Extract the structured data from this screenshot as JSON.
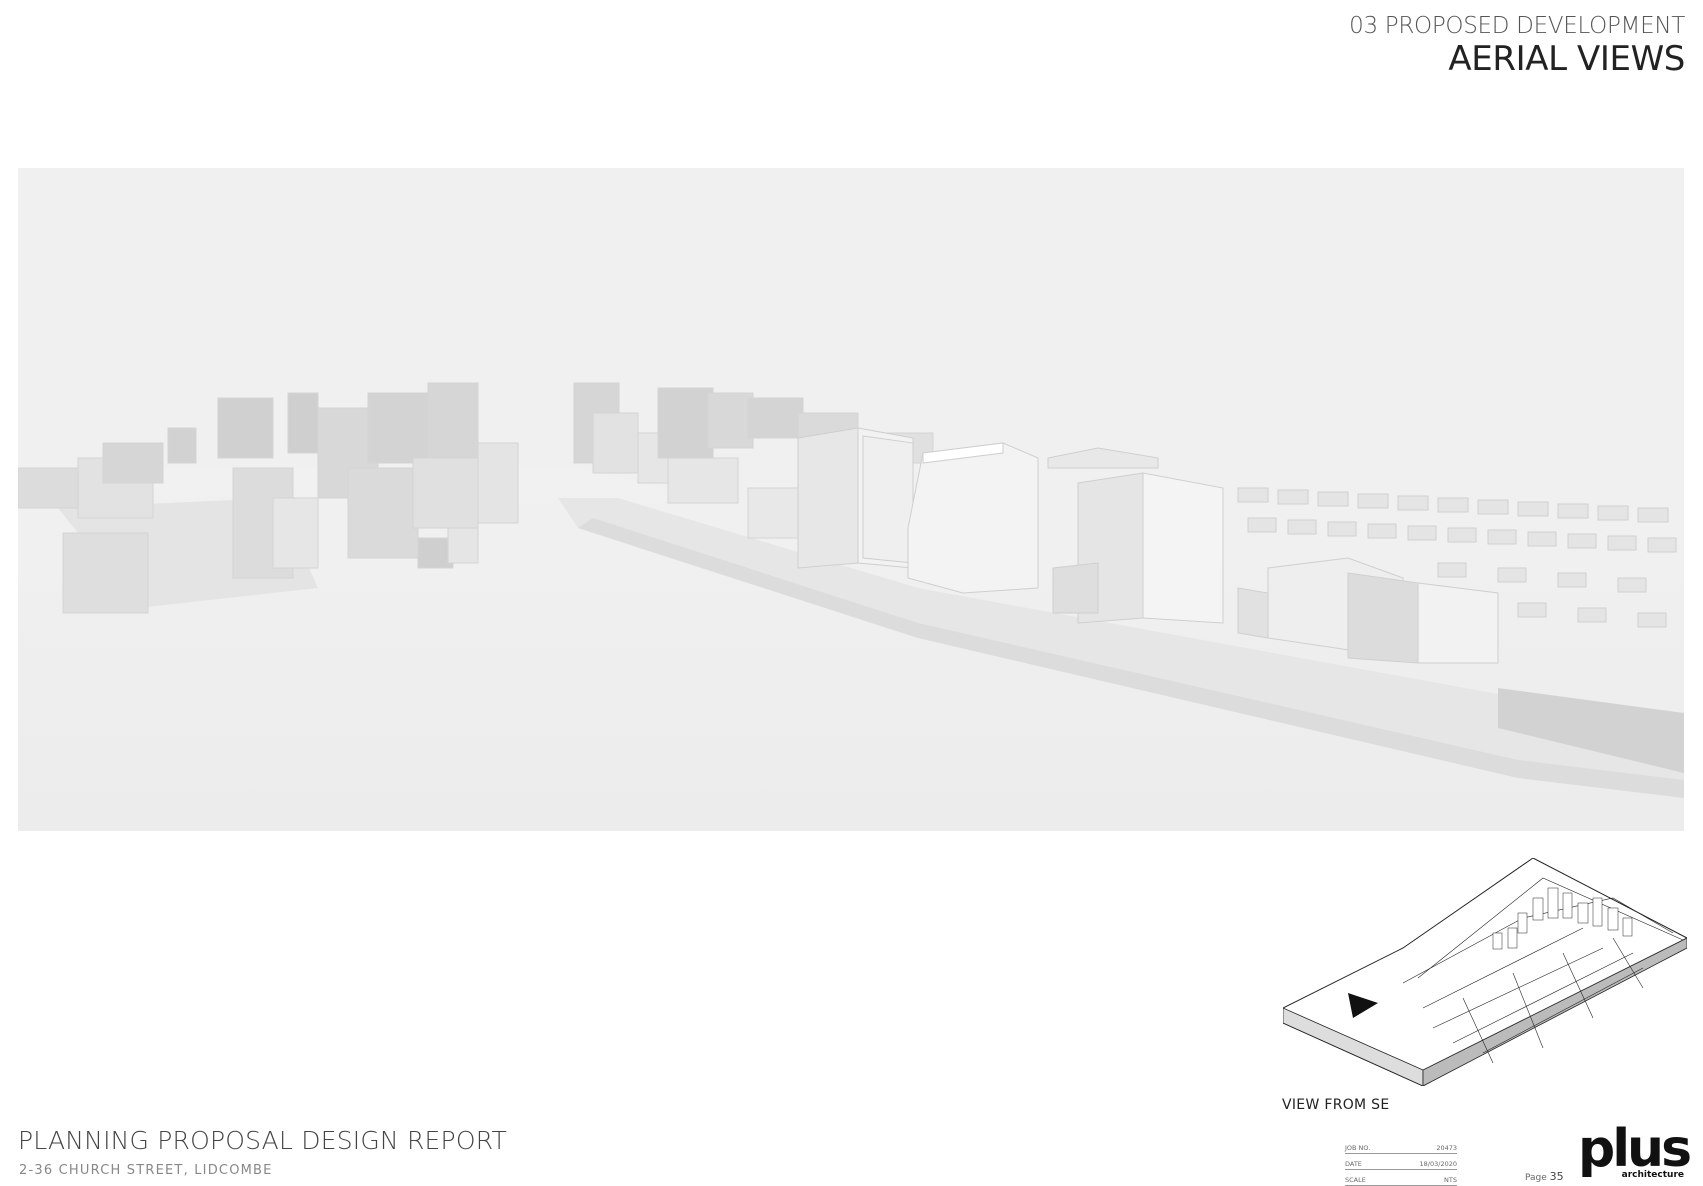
{
  "header": {
    "section_label": "03 PROPOSED DEVELOPMENT",
    "page_title": "AERIAL VIEWS"
  },
  "render": {
    "description_icon": "aerial-massing-model-icon"
  },
  "key_plan": {
    "caption": "VIEW FROM SE"
  },
  "footer": {
    "report_title": "PLANNING PROPOSAL DESIGN REPORT",
    "address": "2-36 CHURCH STREET, LIDCOMBE",
    "title_block": [
      {
        "label": "JOB NO.",
        "value": "20473"
      },
      {
        "label": "DATE",
        "value": "18/03/2020"
      },
      {
        "label": "SCALE",
        "value": "NTS"
      }
    ],
    "page_label": "Page",
    "page_number": "35"
  },
  "logo": {
    "word": "plus",
    "sub": "architecture"
  },
  "colors": {
    "background": "#ffffff",
    "render_bg": "#efefef",
    "title": "#222222"
  }
}
